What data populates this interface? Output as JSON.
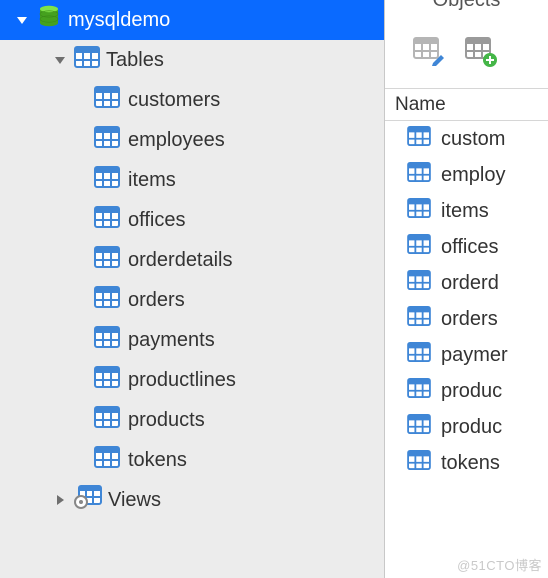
{
  "sidebar": {
    "database": {
      "name": "mysqldemo",
      "expanded": true
    },
    "tables_group": {
      "label": "Tables",
      "expanded": true
    },
    "tables": [
      {
        "name": "customers"
      },
      {
        "name": "employees"
      },
      {
        "name": "items"
      },
      {
        "name": "offices"
      },
      {
        "name": "orderdetails"
      },
      {
        "name": "orders"
      },
      {
        "name": "payments"
      },
      {
        "name": "productlines"
      },
      {
        "name": "products"
      },
      {
        "name": "tokens"
      }
    ],
    "views_group": {
      "label": "Views",
      "expanded": false
    }
  },
  "panel": {
    "title": "Objects",
    "column_header": "Name",
    "toolbar": {
      "design_icon": "design-table-icon",
      "new_icon": "new-table-icon"
    },
    "rows": [
      {
        "name": "custom"
      },
      {
        "name": "employ"
      },
      {
        "name": "items"
      },
      {
        "name": "offices"
      },
      {
        "name": "orderd"
      },
      {
        "name": "orders"
      },
      {
        "name": "paymer"
      },
      {
        "name": "produc"
      },
      {
        "name": "produc"
      },
      {
        "name": "tokens"
      }
    ]
  },
  "watermark": "@51CTO博客",
  "colors": {
    "selection": "#0a6aff",
    "icon_blue": "#3f86d6",
    "icon_green": "#45b648"
  }
}
